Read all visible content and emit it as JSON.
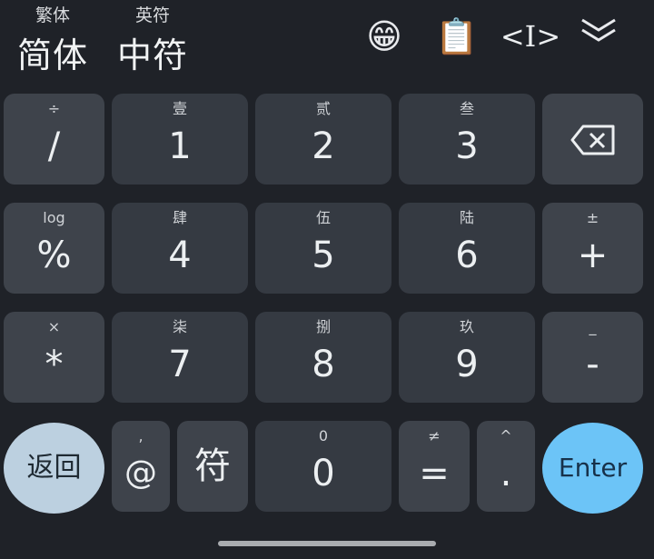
{
  "toolbar": {
    "script_mode": {
      "hint": "繁体",
      "label": "简体"
    },
    "symbol_mode": {
      "hint": "英符",
      "label": "中符"
    },
    "emoji": "😁",
    "clipboard": "📋",
    "cursor_edit": "<I>",
    "collapse": "﹀"
  },
  "keys": {
    "divide": {
      "top": "÷",
      "label": "/"
    },
    "one": {
      "top": "壹",
      "label": "1"
    },
    "two": {
      "top": "贰",
      "label": "2"
    },
    "three": {
      "top": "叁",
      "label": "3"
    },
    "backspace": {
      "label": "⌫"
    },
    "percent": {
      "top": "log",
      "label": "%"
    },
    "four": {
      "top": "肆",
      "label": "4"
    },
    "five": {
      "top": "伍",
      "label": "5"
    },
    "six": {
      "top": "陆",
      "label": "6"
    },
    "plus": {
      "top": "±",
      "label": "+"
    },
    "multiply": {
      "top": "×",
      "label": "*"
    },
    "seven": {
      "top": "柒",
      "label": "7"
    },
    "eight": {
      "top": "捌",
      "label": "8"
    },
    "nine": {
      "top": "玖",
      "label": "9"
    },
    "minus": {
      "top": "_",
      "label": "-"
    },
    "back": {
      "label": "返回"
    },
    "at": {
      "top": ",",
      "label": "@"
    },
    "symbol": {
      "label": "符"
    },
    "zero": {
      "top": "0",
      "label": "0"
    },
    "equals": {
      "top": "≠",
      "label": "="
    },
    "dot": {
      "top": "^",
      "label": "."
    },
    "enter": {
      "label": "Enter"
    }
  },
  "colors": {
    "background": "#1f2228",
    "key": "#353a42",
    "function_key": "#3e434b",
    "back_key": "#bcd0e0",
    "enter_key": "#6cc4f7"
  }
}
